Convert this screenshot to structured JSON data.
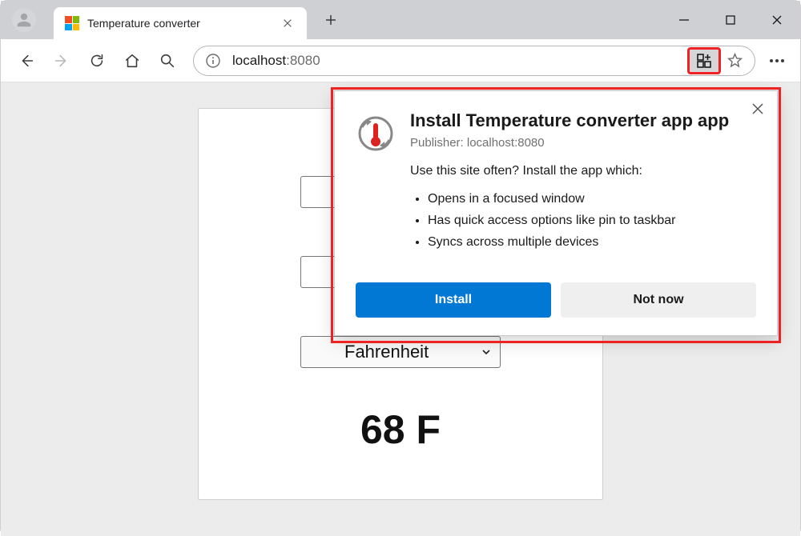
{
  "window": {
    "tab_title": "Temperature converter"
  },
  "toolbar": {
    "url_host": "localhost",
    "url_port": ":8080"
  },
  "app": {
    "select_label": "Fahrenheit",
    "result": "68 F"
  },
  "popup": {
    "title": "Install Temperature converter app app",
    "publisher": "Publisher: localhost:8080",
    "subhead": "Use this site often? Install the app which:",
    "bullets": [
      "Opens in a focused window",
      "Has quick access options like pin to taskbar",
      "Syncs across multiple devices"
    ],
    "install_label": "Install",
    "notnow_label": "Not now"
  }
}
